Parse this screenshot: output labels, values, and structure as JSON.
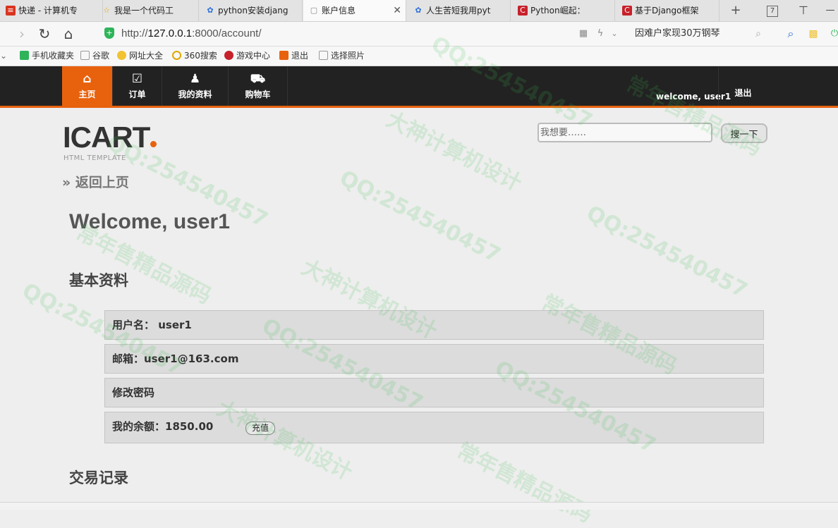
{
  "browser": {
    "tabs": [
      {
        "label": "快递 - 计算机专",
        "icon_color": "#d9341f",
        "icon": "≡"
      },
      {
        "label": "我是一个代码工",
        "icon_color": "#f1c232",
        "icon": "☆"
      },
      {
        "label": "python安装djang",
        "icon_color": "#2a6fdb",
        "icon": "✿"
      },
      {
        "label": "账户信息",
        "icon_color": "#ffffff",
        "icon": "▢"
      },
      {
        "label": "人生苦短我用pyt",
        "icon_color": "#2a6fdb",
        "icon": "✿"
      },
      {
        "label": "Python崛起：",
        "icon_color": "#c7212b",
        "icon": "C"
      },
      {
        "label": "基于Django框架",
        "icon_color": "#c7212b",
        "icon": "C"
      }
    ],
    "tab_count": "7",
    "url_scheme_host": "http://",
    "url_host": "127.0.0.1",
    "url_rest": ":8000/account/",
    "news_ticker": "因难户家现30万钢琴",
    "bookmarks": [
      {
        "label": "手机收藏夹",
        "color": "#2fb45a"
      },
      {
        "label": "谷歌",
        "color": "#ffffff"
      },
      {
        "label": "网址大全",
        "color": "#f1c232"
      },
      {
        "label": "360搜索",
        "color": "#f1c232"
      },
      {
        "label": "游戏中心",
        "color": "#c7212b"
      },
      {
        "label": "退出",
        "color": "#e8620e"
      },
      {
        "label": "选择照片",
        "color": "#ffffff"
      }
    ]
  },
  "site": {
    "nav": [
      {
        "label": "主页",
        "icon": "⌂",
        "active": true
      },
      {
        "label": "订单",
        "icon": "☑",
        "active": false
      },
      {
        "label": "我的资料",
        "icon": "♟",
        "active": false
      },
      {
        "label": "购物车",
        "icon": "🛒",
        "active": false
      }
    ],
    "welcome": "welcome, user1",
    "logout": "退出",
    "logo": "ICART",
    "logo_sub": "HTML TEMPLATE",
    "search_placeholder": "我想要……",
    "search_button": "搜一下",
    "accent_color": "#e8620e"
  },
  "main": {
    "back_link": "» 返回上页",
    "title": "Welcome, user1",
    "profile_heading": "基本资料",
    "username_row": "用户名： user1",
    "email_row": "邮箱：user1@163.com",
    "change_password": "修改密码",
    "balance_row": "我的余额：1850.00",
    "recharge_button": "充值",
    "transactions_heading": "交易记录"
  },
  "watermarks": {
    "qq": "QQ:254540457",
    "slogan1": "大神计算机设计",
    "slogan2": "常年售精品源码"
  }
}
